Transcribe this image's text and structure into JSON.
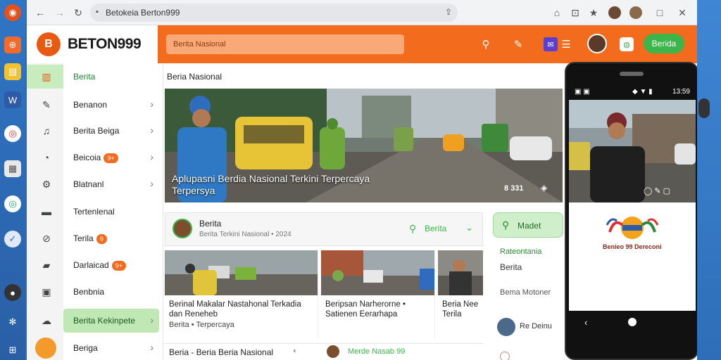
{
  "browser": {
    "url": "Betokeia Berton999"
  },
  "header": {
    "logo_text": "BETON999",
    "search_placeholder": "Berita Nasional",
    "login_label": "Berida"
  },
  "sidebar": {
    "items": [
      {
        "label": "Berita",
        "icon": "home-icon",
        "active": false
      },
      {
        "label": "Benanon",
        "icon": "edit-icon",
        "chevron": true
      },
      {
        "label": "Berita Beiga",
        "icon": "bell-icon",
        "chevron": true
      },
      {
        "label": "Beicoia",
        "icon": "chat-icon",
        "badge": "9+",
        "chevron": true
      },
      {
        "label": "Blatnanl",
        "icon": "gear-icon",
        "chevron": true
      },
      {
        "label": "Tertenlenal",
        "icon": "card-icon"
      },
      {
        "label": "Terila",
        "icon": "tag-icon",
        "badge": "9"
      },
      {
        "label": "Darlaicad",
        "icon": "folder-icon",
        "badge": "9+"
      },
      {
        "label": "Benbnia",
        "icon": "save-icon"
      },
      {
        "label": "Berita Kekinpete",
        "icon": "cloud-icon",
        "active": true,
        "chevron": true
      },
      {
        "label": "Beriga",
        "icon": "profile-icon",
        "chevron": true
      }
    ]
  },
  "main": {
    "crumb": "Beria Nasional",
    "hero_caption": "Aplupasni Berdia Nasional Terkini Terpercaya Terpersya",
    "hero_count": "8 331",
    "section_title": "Berita",
    "section_sub": "Berita Terkini Nasional • 2024",
    "section_more": "Berita",
    "cards": [
      {
        "title": "Berinal Makalar Nastahonal Terkadia dan Reneheb",
        "meta": "Berita • Terpercaya"
      },
      {
        "title": "Beripsan Narherorne • Satienen Eerarhapa",
        "meta": ""
      },
      {
        "title": "Beria Nee Terila",
        "meta": ""
      }
    ],
    "bottom_title": "Beria - Beria Beria Nasional",
    "bottom_sub": "Merde Nasab 99"
  },
  "right_panel": {
    "title": "Madet",
    "line1": "Rateontania",
    "line2": "Berita",
    "line3": "Bema Motoner",
    "line4": "Re Deinu"
  },
  "phone": {
    "time": "13:59",
    "logo_caption": "Benieo 99 Dereconi"
  }
}
